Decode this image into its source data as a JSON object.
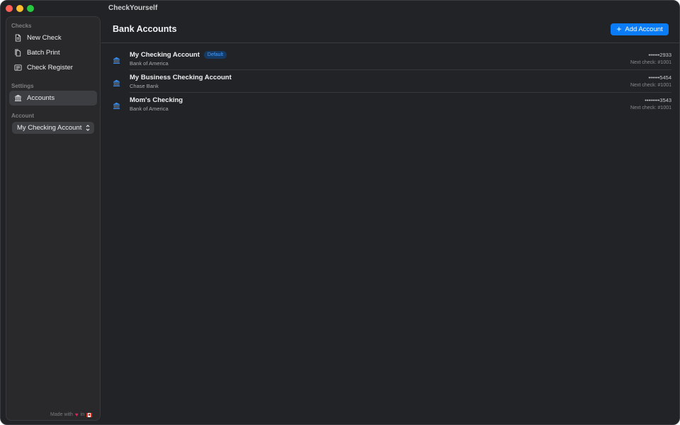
{
  "window": {
    "title": "CheckYourself"
  },
  "sidebar": {
    "sections": {
      "checks": "Checks",
      "settings": "Settings",
      "account": "Account"
    },
    "items": [
      {
        "label": "New Check",
        "icon": "document-icon"
      },
      {
        "label": "Batch Print",
        "icon": "documents-icon"
      },
      {
        "label": "Check Register",
        "icon": "list-icon"
      },
      {
        "label": "Accounts",
        "icon": "bank-icon",
        "selected": true
      }
    ],
    "account_select": {
      "value": "My Checking Account"
    },
    "footer": {
      "made_with": "Made with",
      "in": "in",
      "heart_icon": "heart-icon",
      "flag_icon": "canada-flag-icon"
    }
  },
  "main": {
    "title": "Bank Accounts",
    "add_button": "Add Account",
    "accounts": [
      {
        "name": "My Checking Account",
        "bank": "Bank of America",
        "number": "••••••2933",
        "next_check": "Next check: #1001",
        "badge": "Default"
      },
      {
        "name": "My Business Checking Account",
        "bank": "Chase Bank",
        "number": "••••••5454",
        "next_check": "Next check: #1001"
      },
      {
        "name": "Mom's Checking",
        "bank": "Bank of America",
        "number": "••••••••3543",
        "next_check": "Next check: #1001"
      }
    ]
  },
  "colors": {
    "accent": "#0a7cf7",
    "window_bg": "#212326",
    "sidebar_bg": "#29292c",
    "bank_icon": "#3b8ff0"
  }
}
